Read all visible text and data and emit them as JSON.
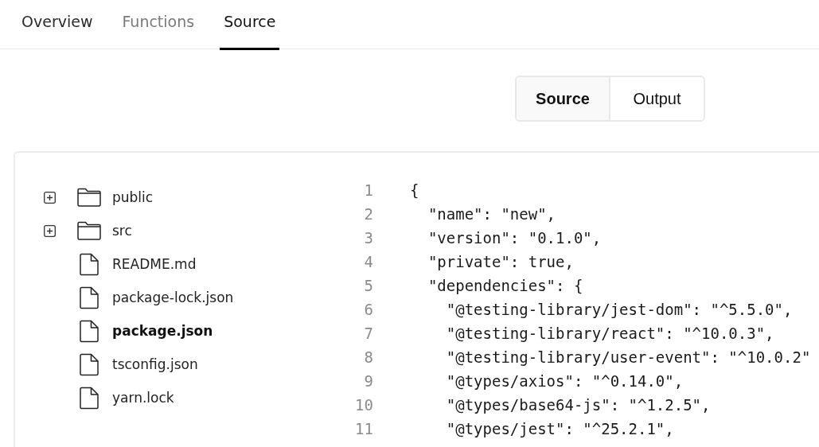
{
  "tabs": [
    {
      "label": "Overview",
      "selected": false,
      "disabled": false
    },
    {
      "label": "Functions",
      "selected": false,
      "disabled": true
    },
    {
      "label": "Source",
      "selected": true,
      "disabled": false
    }
  ],
  "view_toggle": [
    {
      "label": "Source",
      "selected": true
    },
    {
      "label": "Output",
      "selected": false
    }
  ],
  "file_tree": [
    {
      "name": "public",
      "kind": "folder",
      "expanded": false,
      "selected": false
    },
    {
      "name": "src",
      "kind": "folder",
      "expanded": false,
      "selected": false
    },
    {
      "name": "README.md",
      "kind": "file",
      "selected": false
    },
    {
      "name": "package-lock.json",
      "kind": "file",
      "selected": false
    },
    {
      "name": "package.json",
      "kind": "file",
      "selected": true
    },
    {
      "name": "tsconfig.json",
      "kind": "file",
      "selected": false
    },
    {
      "name": "yarn.lock",
      "kind": "file",
      "selected": false
    }
  ],
  "code": {
    "lines": [
      {
        "number": "1",
        "text": "{"
      },
      {
        "number": "2",
        "text": "  \"name\": \"new\","
      },
      {
        "number": "3",
        "text": "  \"version\": \"0.1.0\","
      },
      {
        "number": "4",
        "text": "  \"private\": true,"
      },
      {
        "number": "5",
        "text": "  \"dependencies\": {"
      },
      {
        "number": "6",
        "text": "    \"@testing-library/jest-dom\": \"^5.5.0\","
      },
      {
        "number": "7",
        "text": "    \"@testing-library/react\": \"^10.0.3\","
      },
      {
        "number": "8",
        "text": "    \"@testing-library/user-event\": \"^10.0.2\""
      },
      {
        "number": "9",
        "text": "    \"@types/axios\": \"^0.14.0\","
      },
      {
        "number": "10",
        "text": "    \"@types/base64-js\": \"^1.2.5\","
      },
      {
        "number": "11",
        "text": "    \"@types/jest\": \"^25.2.1\","
      }
    ]
  }
}
